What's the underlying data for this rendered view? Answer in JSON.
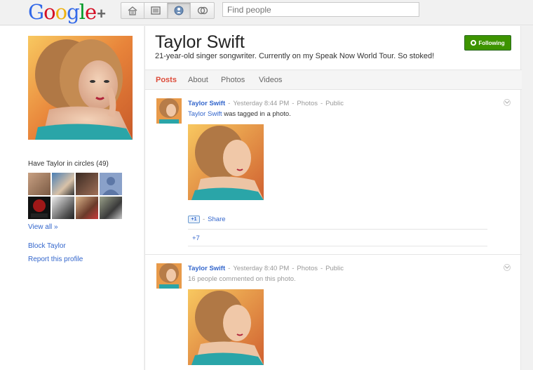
{
  "brand": {
    "logo_letters": [
      "G",
      "o",
      "o",
      "g",
      "l",
      "e"
    ],
    "logo_colors": [
      "#3369e8",
      "#d50f25",
      "#eeb211",
      "#3369e8",
      "#009925",
      "#d50f25"
    ],
    "plus": "+"
  },
  "topnav": {
    "buttons": [
      "home-icon",
      "photos-icon",
      "profile-icon",
      "circles-icon"
    ],
    "active": "profile-icon"
  },
  "search": {
    "placeholder": "Find people"
  },
  "profile": {
    "name": "Taylor Swift",
    "tagline": "21-year-old singer songwriter. Currently on my Speak Now World Tour. So stoked!",
    "follow_label": "Following",
    "follow_color": "#3d9400"
  },
  "sidebar": {
    "circles_title": "Have Taylor in circles (49)",
    "circle_avatars": [
      "person-1",
      "person-2",
      "person-3",
      "default-silhouette",
      "droid-life",
      "person-5",
      "person-6",
      "person-7"
    ],
    "view_all": "View all »",
    "block": "Block Taylor",
    "report": "Report this profile"
  },
  "tabs": [
    "Posts",
    "About",
    "Photos",
    "Videos"
  ],
  "active_tab": "Posts",
  "posts": [
    {
      "author": "Taylor Swift",
      "time": "Yesterday 8:44 PM",
      "category": "Photos",
      "visibility": "Public",
      "body_link": "Taylor Swift",
      "body_text": " was tagged in a photo.",
      "plusone_label": "+1",
      "share_label": "Share",
      "plus_count": "+7"
    },
    {
      "author": "Taylor Swift",
      "time": "Yesterday 8:40 PM",
      "category": "Photos",
      "visibility": "Public",
      "body_text": "16 people commented on this photo."
    }
  ],
  "separator": "-"
}
